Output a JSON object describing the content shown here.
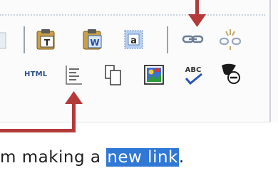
{
  "toolbar": {
    "row1": {
      "buttons": [
        {
          "icon": "paste-text-icon",
          "label": "T"
        },
        {
          "icon": "paste-word-icon",
          "label": "W"
        },
        {
          "icon": "select-all-icon",
          "label": "a"
        },
        {
          "icon": "link-icon"
        },
        {
          "icon": "unlink-icon"
        }
      ]
    },
    "row2": {
      "html_label": "HTML",
      "buttons": [
        {
          "icon": "show-blocks-icon"
        },
        {
          "icon": "copy-icon"
        },
        {
          "icon": "image-icon"
        },
        {
          "icon": "spell-check-icon",
          "label": "ABC"
        },
        {
          "icon": "remove-format-icon"
        }
      ]
    }
  },
  "editor": {
    "text_before": "m making a ",
    "selected_text": "new link",
    "text_after": "."
  },
  "colors": {
    "annotation": "#b43a3a",
    "selection": "#2f78d6",
    "html_label": "#2d4f87"
  }
}
